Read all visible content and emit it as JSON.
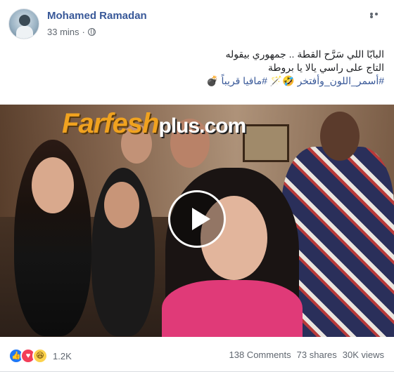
{
  "post": {
    "author": "Mohamed Ramadan",
    "time": "33 mins",
    "privacy_icon": "globe-icon",
    "text_lines": [
      "البابّا اللي سَرَّح القطة .. جمهوري بيقوله",
      "التاج على راسي يالا يا بروطة",
      "#أسمر_اللون_وأفتخر 🤣🪄 #مافيا قريباً 💣"
    ]
  },
  "video": {
    "watermark_main": "Farfesh",
    "watermark_suffix": "plus.com",
    "play_icon": "play-icon"
  },
  "footer": {
    "reaction_icons": [
      "like-icon",
      "love-icon",
      "haha-icon"
    ],
    "reaction_count": "1.2K",
    "comments": "138 Comments",
    "shares": "73 shares",
    "views": "30K views"
  },
  "colors": {
    "name": "#385898",
    "meta": "#606770",
    "like": "#2078f4",
    "love": "#f33e58",
    "haha": "#fcd24d"
  }
}
